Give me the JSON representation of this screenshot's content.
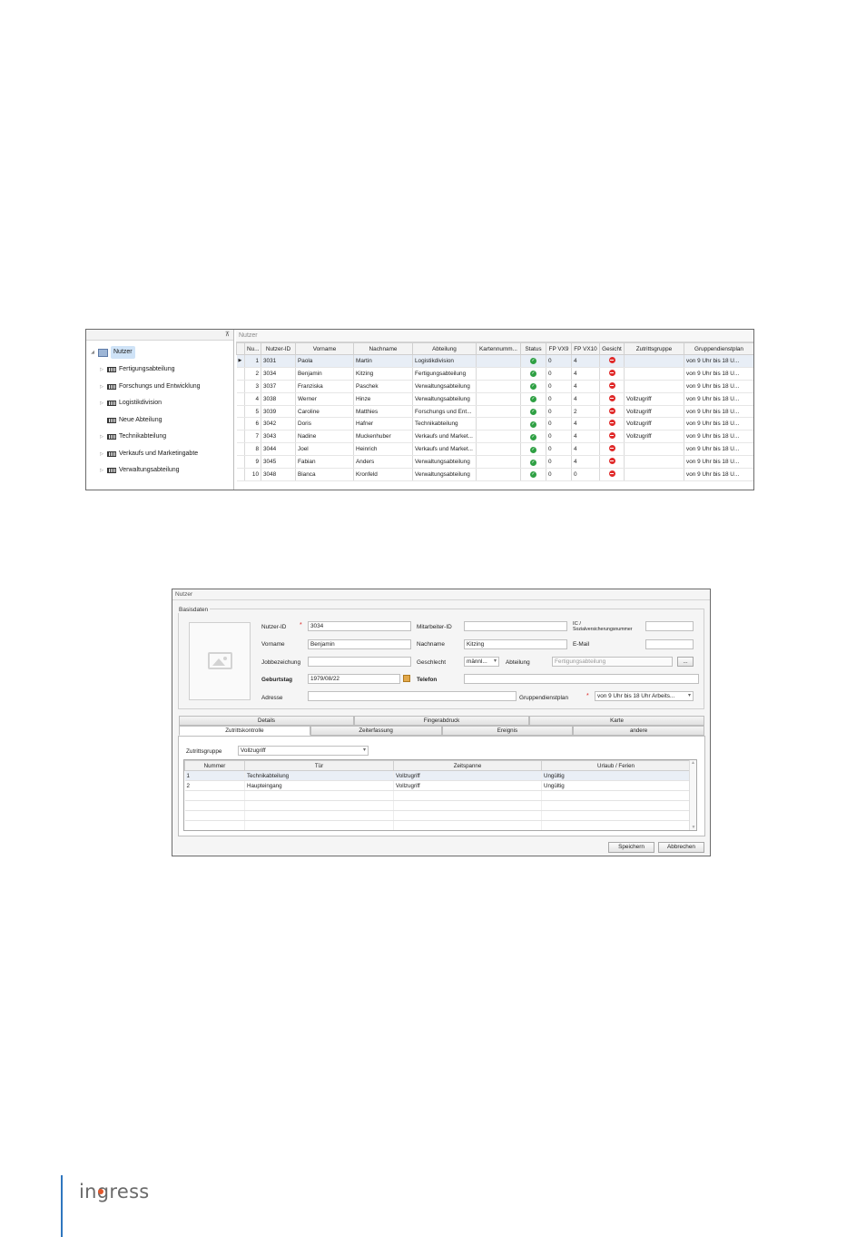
{
  "list_window": {
    "grid_caption": "Nutzer",
    "tree": {
      "root": "Nutzer",
      "items": [
        {
          "label": "Fertigungsabteilung",
          "expandable": true
        },
        {
          "label": "Forschungs und Entwicklung",
          "expandable": true
        },
        {
          "label": "Logistikdivision",
          "expandable": true
        },
        {
          "label": "Neue Abteilung",
          "expandable": false
        },
        {
          "label": "Technikabteilung",
          "expandable": true
        },
        {
          "label": "Verkaufs und Marketingabte",
          "expandable": true
        },
        {
          "label": "Verwaltungsabteilung",
          "expandable": true
        }
      ]
    },
    "columns": [
      "Nu...",
      "Nutzer-ID",
      "Vorname",
      "Nachname",
      "Abteilung",
      "Kartennumm...",
      "Status",
      "FP VX9",
      "FP VX10",
      "Gesicht",
      "Zutrittsgruppe",
      "Gruppendienstplan"
    ],
    "rows": [
      {
        "nr": "1",
        "id": "3031",
        "vorname": "Paola",
        "nachname": "Martin",
        "abteilung": "Logistikdivision",
        "karte": "",
        "fp9": "0",
        "fp10": "4",
        "gruppe": "",
        "plan": "von 9 Uhr bis 18 U..."
      },
      {
        "nr": "2",
        "id": "3034",
        "vorname": "Benjamin",
        "nachname": "Kitzing",
        "abteilung": "Fertigungsabteilung",
        "karte": "",
        "fp9": "0",
        "fp10": "4",
        "gruppe": "",
        "plan": "von 9 Uhr bis 18 U..."
      },
      {
        "nr": "3",
        "id": "3037",
        "vorname": "Franziska",
        "nachname": "Paschek",
        "abteilung": "Verwaltungsabteilung",
        "karte": "",
        "fp9": "0",
        "fp10": "4",
        "gruppe": "",
        "plan": "von 9 Uhr bis 18 U..."
      },
      {
        "nr": "4",
        "id": "3038",
        "vorname": "Werner",
        "nachname": "Hinze",
        "abteilung": "Verwaltungsabteilung",
        "karte": "",
        "fp9": "0",
        "fp10": "4",
        "gruppe": "Vollzugriff",
        "plan": "von 9 Uhr bis 18 U..."
      },
      {
        "nr": "5",
        "id": "3039",
        "vorname": "Caroline",
        "nachname": "Matthies",
        "abteilung": "Forschungs und Ent...",
        "karte": "",
        "fp9": "0",
        "fp10": "2",
        "gruppe": "Vollzugriff",
        "plan": "von 9 Uhr bis 18 U..."
      },
      {
        "nr": "6",
        "id": "3042",
        "vorname": "Doris",
        "nachname": "Hafner",
        "abteilung": "Technikabteilung",
        "karte": "",
        "fp9": "0",
        "fp10": "4",
        "gruppe": "Vollzugriff",
        "plan": "von 9 Uhr bis 18 U..."
      },
      {
        "nr": "7",
        "id": "3043",
        "vorname": "Nadine",
        "nachname": "Muckenhuber",
        "abteilung": "Verkaufs und Market...",
        "karte": "",
        "fp9": "0",
        "fp10": "4",
        "gruppe": "Vollzugriff",
        "plan": "von 9 Uhr bis 18 U..."
      },
      {
        "nr": "8",
        "id": "3044",
        "vorname": "Joel",
        "nachname": "Heinrich",
        "abteilung": "Verkaufs und Market...",
        "karte": "",
        "fp9": "0",
        "fp10": "4",
        "gruppe": "",
        "plan": "von 9 Uhr bis 18 U..."
      },
      {
        "nr": "9",
        "id": "3045",
        "vorname": "Fabian",
        "nachname": "Anders",
        "abteilung": "Verwaltungsabteilung",
        "karte": "",
        "fp9": "0",
        "fp10": "4",
        "gruppe": "",
        "plan": "von 9 Uhr bis 18 U..."
      },
      {
        "nr": "10",
        "id": "3048",
        "vorname": "Bianca",
        "nachname": "Kronfeld",
        "abteilung": "Verwaltungsabteilung",
        "karte": "",
        "fp9": "0",
        "fp10": "0",
        "gruppe": "",
        "plan": "von 9 Uhr bis 18 U..."
      }
    ],
    "status_color": "#2ea043",
    "face_color": "#e02a2a"
  },
  "form_window": {
    "title": "Nutzer",
    "basisdaten_legend": "Basisdaten",
    "labels": {
      "nutzer_id": "Nutzer-ID",
      "vorname": "Vorname",
      "jobbezeichnung": "Jobbezeichung",
      "geburtstag": "Geburtstag",
      "adresse": "Adresse",
      "mitarbeiter_id": "Mitarbeiter-ID",
      "nachname": "Nachname",
      "geschlecht": "Geschlecht",
      "telefon": "Telefon",
      "ic_line1": "IC /",
      "ic_line2": "Sozialversicherungsnummer",
      "email": "E-Mail",
      "abteilung": "Abteilung",
      "gruppendienstplan": "Gruppendienstplan",
      "required_mark": "*"
    },
    "values": {
      "nutzer_id": "3034",
      "vorname": "Benjamin",
      "jobbezeichnung": "",
      "geburtstag": "1979/08/22",
      "adresse": "",
      "mitarbeiter_id": "",
      "nachname": "Kitzing",
      "geschlecht": "männl...",
      "telefon": "",
      "ic": "",
      "email": "",
      "abteilung": "Fertigungsabteilung",
      "gruppendienstplan": "von 9 Uhr bis 18 Uhr Arbeits...",
      "browse_button": "..."
    },
    "tabs_row1": [
      "Details",
      "Fingerabdruck",
      "Karte"
    ],
    "tabs_row2": [
      "Zutrittskontrolle",
      "Zeiterfassung",
      "Ereignis",
      "andere"
    ],
    "active_tab": "Zutrittskontrolle",
    "zutrittsgruppe_label": "Zutrittsgruppe",
    "zutrittsgruppe_value": "Vollzugriff",
    "inner_columns": [
      "Nummer",
      "Tür",
      "Zeitspanne",
      "Urlaub / Ferien"
    ],
    "inner_rows": [
      {
        "nummer": "1",
        "tuer": "Technikabteilung",
        "zeitspanne": "Vollzugriff",
        "urlaub": "Ungültig"
      },
      {
        "nummer": "2",
        "tuer": "Haupteingang",
        "zeitspanne": "Vollzugriff",
        "urlaub": "Ungültig"
      }
    ],
    "save_label": "Speichern",
    "cancel_label": "Abbrechen"
  },
  "footer": {
    "logo_text": "ingress",
    "accent": "#2f76bf",
    "logo_dot_color": "#e2572b"
  }
}
